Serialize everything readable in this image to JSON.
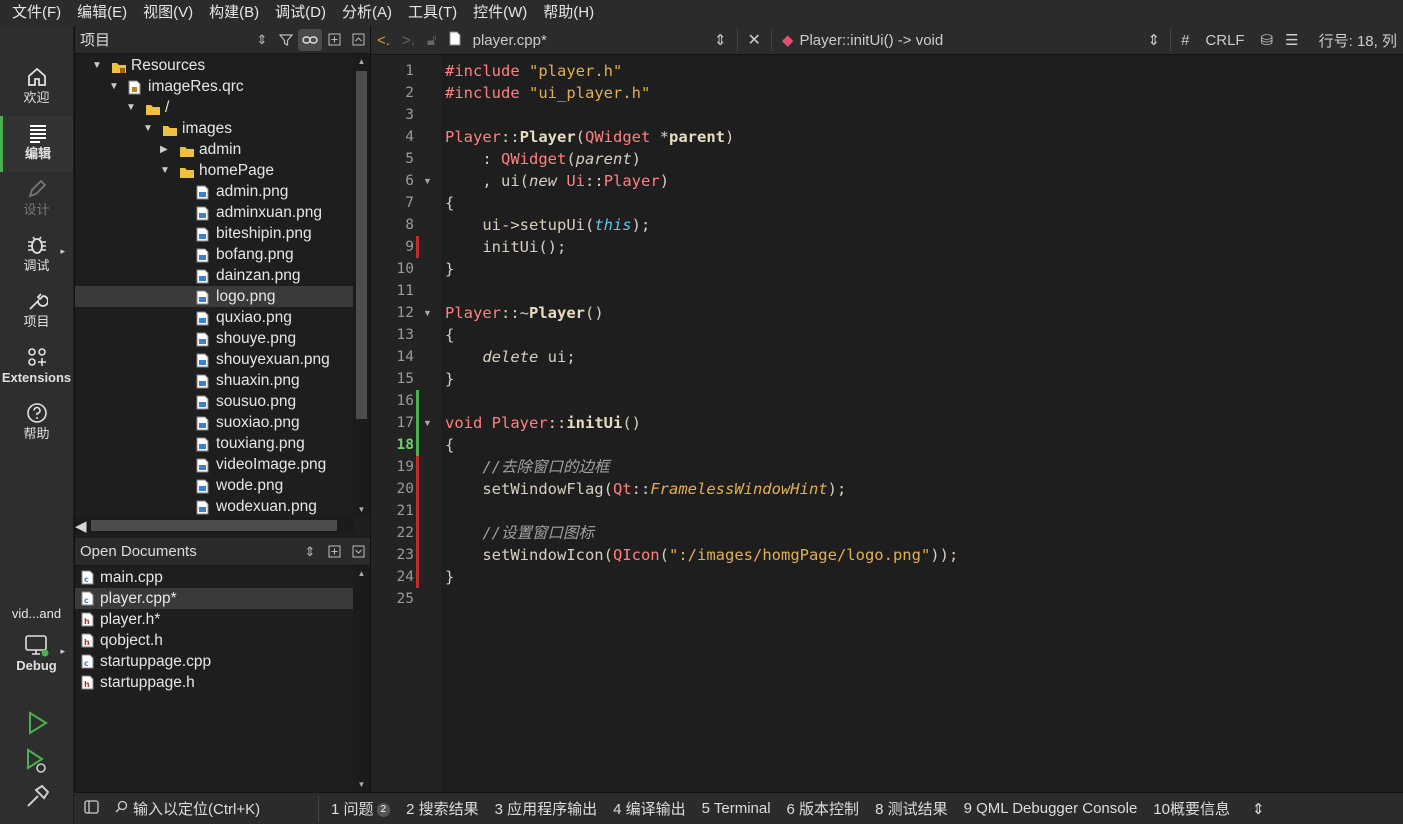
{
  "menubar": [
    "文件(F)",
    "编辑(E)",
    "视图(V)",
    "构建(B)",
    "调试(D)",
    "分析(A)",
    "工具(T)",
    "控件(W)",
    "帮助(H)"
  ],
  "modes": [
    {
      "label": "欢迎",
      "icon": "home-icon"
    },
    {
      "label": "编辑",
      "icon": "edit-icon"
    },
    {
      "label": "设计",
      "icon": "design-icon"
    },
    {
      "label": "调试",
      "icon": "bug-icon"
    },
    {
      "label": "项目",
      "icon": "wrench-icon"
    },
    {
      "label": "Extensions",
      "icon": "extensions-icon"
    },
    {
      "label": "帮助",
      "icon": "help-icon"
    }
  ],
  "run_target": {
    "project": "vid...and",
    "mode": "Debug"
  },
  "project_pane": {
    "title": "项目",
    "tree": [
      {
        "label": "Resources",
        "depth": 0,
        "kind": "folder-lock",
        "expanded": true
      },
      {
        "label": "imageRes.qrc",
        "depth": 1,
        "kind": "qrc",
        "expanded": true
      },
      {
        "label": "/",
        "depth": 2,
        "kind": "folder",
        "expanded": true
      },
      {
        "label": "images",
        "depth": 3,
        "kind": "folder",
        "expanded": true
      },
      {
        "label": "admin",
        "depth": 4,
        "kind": "folder",
        "expanded": false
      },
      {
        "label": "homePage",
        "depth": 4,
        "kind": "folder",
        "expanded": true
      },
      {
        "label": "admin.png",
        "depth": 5,
        "kind": "image"
      },
      {
        "label": "adminxuan.png",
        "depth": 5,
        "kind": "image"
      },
      {
        "label": "biteshipin.png",
        "depth": 5,
        "kind": "image"
      },
      {
        "label": "bofang.png",
        "depth": 5,
        "kind": "image"
      },
      {
        "label": "dainzan.png",
        "depth": 5,
        "kind": "image"
      },
      {
        "label": "logo.png",
        "depth": 5,
        "kind": "image",
        "selected": true
      },
      {
        "label": "quxiao.png",
        "depth": 5,
        "kind": "image"
      },
      {
        "label": "shouye.png",
        "depth": 5,
        "kind": "image"
      },
      {
        "label": "shouyexuan.png",
        "depth": 5,
        "kind": "image"
      },
      {
        "label": "shuaxin.png",
        "depth": 5,
        "kind": "image"
      },
      {
        "label": "sousuo.png",
        "depth": 5,
        "kind": "image"
      },
      {
        "label": "suoxiao.png",
        "depth": 5,
        "kind": "image"
      },
      {
        "label": "touxiang.png",
        "depth": 5,
        "kind": "image"
      },
      {
        "label": "videoImage.png",
        "depth": 5,
        "kind": "image"
      },
      {
        "label": "wode.png",
        "depth": 5,
        "kind": "image"
      },
      {
        "label": "wodexuan.png",
        "depth": 5,
        "kind": "image"
      }
    ]
  },
  "open_documents": {
    "title": "Open Documents",
    "files": [
      {
        "label": "main.cpp",
        "kind": "cpp"
      },
      {
        "label": "player.cpp*",
        "kind": "cpp",
        "selected": true
      },
      {
        "label": "player.h*",
        "kind": "h"
      },
      {
        "label": "qobject.h",
        "kind": "h"
      },
      {
        "label": "startuppage.cpp",
        "kind": "cpp"
      },
      {
        "label": "startuppage.h",
        "kind": "h"
      }
    ]
  },
  "editor_bar": {
    "file": "player.cpp*",
    "symbol": "Player::initUi() -> void",
    "hash": "#",
    "line_ending": "CRLF",
    "position": "行号: 18, 列"
  },
  "editor": {
    "current_line": 18,
    "line_count": 25,
    "lines": [
      [
        [
          "kw-pre",
          "#include "
        ],
        [
          "str",
          "\"player.h\""
        ]
      ],
      [
        [
          "kw-pre",
          "#include "
        ],
        [
          "str",
          "\"ui_player.h\""
        ]
      ],
      [],
      [
        [
          "cls",
          "Player"
        ],
        [
          "",
          "::"
        ],
        [
          "fn-b",
          "Player"
        ],
        [
          "",
          "("
        ],
        [
          "cls",
          "QWidget"
        ],
        [
          "",
          " *"
        ],
        [
          "par",
          "parent"
        ],
        [
          "",
          ")"
        ]
      ],
      [
        [
          "",
          "    : "
        ],
        [
          "cls",
          "QWidget"
        ],
        [
          "",
          "("
        ],
        [
          "it",
          "parent"
        ],
        [
          "",
          ")"
        ]
      ],
      [
        [
          "",
          "    , ui("
        ],
        [
          "kwi",
          "new"
        ],
        [
          "",
          " "
        ],
        [
          "cls",
          "Ui"
        ],
        [
          "",
          "::"
        ],
        [
          "cls",
          "Player"
        ],
        [
          "",
          ")"
        ]
      ],
      [
        [
          "",
          "{"
        ]
      ],
      [
        [
          "",
          "    ui->setupUi("
        ],
        [
          "this",
          "this"
        ],
        [
          "",
          ");"
        ]
      ],
      [
        [
          "",
          "    initUi();"
        ]
      ],
      [
        [
          "",
          "}"
        ]
      ],
      [],
      [
        [
          "cls",
          "Player"
        ],
        [
          "",
          "::~"
        ],
        [
          "fn-b",
          "Player"
        ],
        [
          "",
          "()"
        ]
      ],
      [
        [
          "",
          "{"
        ]
      ],
      [
        [
          "",
          "    "
        ],
        [
          "kwi",
          "delete"
        ],
        [
          "",
          " ui;"
        ]
      ],
      [
        [
          "",
          "}"
        ]
      ],
      [],
      [
        [
          "kw",
          "void "
        ],
        [
          "cls",
          "Player"
        ],
        [
          "",
          "::"
        ],
        [
          "fn-b",
          "initUi"
        ],
        [
          "",
          "()"
        ]
      ],
      [
        [
          "",
          "{"
        ]
      ],
      [
        [
          "",
          "    "
        ],
        [
          "cmt",
          "//去除窗口的边框"
        ]
      ],
      [
        [
          "",
          "    setWindowFlag("
        ],
        [
          "cls",
          "Qt"
        ],
        [
          "",
          "::"
        ],
        [
          "en",
          "FramelessWindowHint"
        ],
        [
          "",
          ");"
        ]
      ],
      [],
      [
        [
          "",
          "    "
        ],
        [
          "cmt",
          "//设置窗口图标"
        ]
      ],
      [
        [
          "",
          "    setWindowIcon("
        ],
        [
          "cls",
          "QIcon"
        ],
        [
          "",
          "("
        ],
        [
          "str",
          "\":/images/homgPage/logo.png\""
        ],
        [
          "",
          "));"
        ]
      ],
      [
        [
          "",
          "}"
        ]
      ],
      []
    ],
    "red_marks": [
      9,
      19,
      20,
      21,
      22,
      23,
      24
    ],
    "green_marks": [
      16,
      17,
      18
    ],
    "fold_lines": [
      6,
      12,
      17
    ]
  },
  "statusbar": {
    "locator_placeholder": "输入以定位(Ctrl+K)",
    "tabs": [
      "1 问题",
      "2 搜索结果",
      "3 应用程序输出",
      "4 编译输出",
      "5 Terminal",
      "6 版本控制",
      "8 测试结果",
      "9 QML Debugger Console",
      "10概要信息"
    ],
    "issue_count": "2"
  },
  "colors": {
    "accent": "#4caf50",
    "error_mark": "#c42b2b",
    "string": "#e0b050",
    "keyword": "#ff8080"
  }
}
